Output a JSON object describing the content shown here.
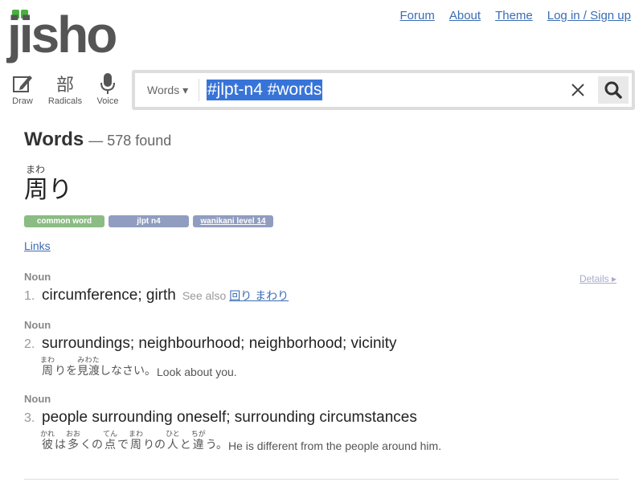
{
  "nav": {
    "forum": "Forum",
    "about": "About",
    "theme": "Theme",
    "login": "Log in / Sign up"
  },
  "logo": {
    "text": "jisho"
  },
  "tools": {
    "draw": "Draw",
    "radicals_glyph": "部",
    "radicals": "Radicals",
    "voice": "Voice"
  },
  "search": {
    "scope": "Words ▾",
    "query": "#jlpt-n4 #words"
  },
  "results": {
    "heading": "Words",
    "count": "— 578 found"
  },
  "entry": {
    "furigana": "まわ",
    "word": "周り",
    "tags": {
      "common": "common word",
      "jlpt": "jlpt n4",
      "wanikani": "wanikani level 14"
    },
    "links": "Links",
    "details": "Details ▸",
    "meanings": [
      {
        "pos": "Noun",
        "num": "1.",
        "def": "circumference; girth",
        "see_also_label": "See also",
        "see_also_link": "回り まわり"
      },
      {
        "pos": "Noun",
        "num": "2.",
        "def": "surroundings; neighbourhood; neighborhood; vicinity",
        "sentence": {
          "ja1": "周",
          "ja1_rt": "まわ",
          "ja2": "りを",
          "ja3": "見渡",
          "ja3_rt": "みわた",
          "ja4": "しなさい。",
          "en": "Look about you."
        }
      },
      {
        "pos": "Noun",
        "num": "3.",
        "def": "people surrounding oneself; surrounding circumstances",
        "sentence": {
          "ja1": "彼",
          "ja1_rt": "かれ",
          "ja2": "は",
          "ja3": "多",
          "ja3_rt": "おお",
          "ja4": "くの",
          "ja5": "点",
          "ja5_rt": "てん",
          "ja6": "で",
          "ja7": "周",
          "ja7_rt": "まわ",
          "ja8": "りの",
          "ja9": "人",
          "ja9_rt": "ひと",
          "ja10": "と",
          "ja11": "違",
          "ja11_rt": "ちが",
          "ja12": "う。",
          "en": "He is different from the people around him."
        }
      }
    ]
  },
  "colors": {
    "accent": "#47b33c",
    "link": "#3b6db3",
    "selection": "#3874d8",
    "tag_common": "#8abc83",
    "tag_jlpt": "#909dc0"
  }
}
